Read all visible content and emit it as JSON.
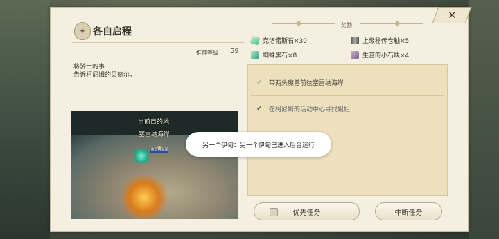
{
  "quest": {
    "title": "各自启程",
    "level_label": "推荐等级",
    "level_value": "59",
    "description": [
      "将骑士的事",
      "告诉柯尼姆的贝德尔。"
    ]
  },
  "rewards": {
    "header": "奖励",
    "items": [
      {
        "label": "克洛诺斯石×30",
        "icon": "gem-icon"
      },
      {
        "label": "上级秘传卷轴×5",
        "icon": "scroll-icon"
      },
      {
        "label": "蜘蛛黑石×8",
        "icon": "gem-icon"
      },
      {
        "label": "生苔的小石块×4",
        "icon": "stone-icon"
      }
    ]
  },
  "objectives": [
    {
      "label": "带两头魔兽前往塞雷纳海岸",
      "done": false
    },
    {
      "label": "在柯尼姆的活动中心寻找姐姐",
      "done": true
    }
  ],
  "map": {
    "current_destination_label": "当前目的地",
    "destination_name": "塞雷纳海岸",
    "marker_label": "塞雷纳海岸"
  },
  "toast": {
    "message": "另一个伊甸：另一个伊甸已进入后台运行"
  },
  "buttons": {
    "priority": "优先任务",
    "abort": "中断任务",
    "close": "✕"
  }
}
